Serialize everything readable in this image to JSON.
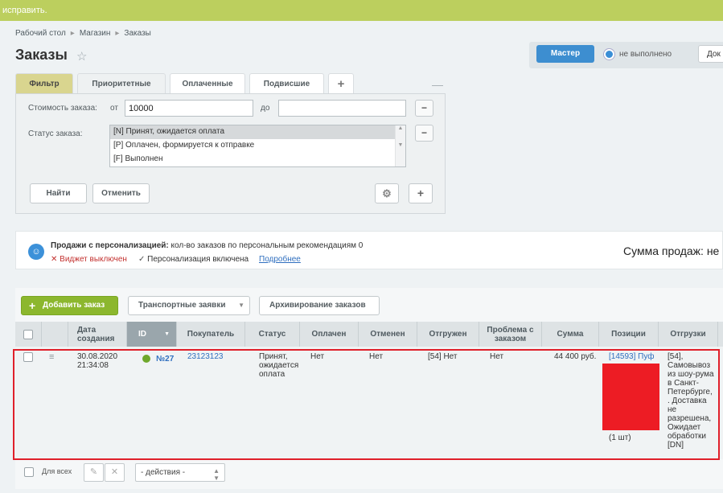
{
  "notice": {
    "text": "исправить."
  },
  "breadcrumb": [
    "Рабочий стол",
    "Магазин",
    "Заказы"
  ],
  "page": {
    "title": "Заказы"
  },
  "master": {
    "button": "Мастер",
    "status": "не выполнено",
    "doc_button": "Док"
  },
  "filter_tabs": [
    "Фильтр",
    "Приоритетные",
    "Оплаченные",
    "Подвисшие"
  ],
  "filter": {
    "price_label": "Стоимость заказа:",
    "from_label": "от",
    "from_value": "10000",
    "to_label": "до",
    "to_value": "",
    "status_label": "Статус заказа:",
    "status_options": [
      "[N] Принят, ожидается оплата",
      "[P] Оплачен, формируется к отправке",
      "[F] Выполнен"
    ],
    "find_button": "Найти",
    "cancel_button": "Отменить"
  },
  "promo": {
    "title_bold": "Продажи с персонализацией:",
    "title_rest": " кол-во заказов по персональным рекомендациям 0",
    "widget_off": "Виджет выключен",
    "personalization_on": "Персонализация включена",
    "more_link": "Подробнее",
    "sum_text": "Сумма продаж: не"
  },
  "toolbar": {
    "add_order": "Добавить заказ",
    "transport": "Транспортные заявки",
    "archive": "Архивирование заказов"
  },
  "columns": {
    "date": "Дата создания",
    "id": "ID",
    "buyer": "Покупатель",
    "status": "Статус",
    "paid": "Оплачен",
    "canceled": "Отменен",
    "shipped": "Отгружен",
    "problem": "Проблема с заказом",
    "sum": "Сумма",
    "positions": "Позиции",
    "shipments": "Отгрузки"
  },
  "order": {
    "date": "30.08.2020",
    "time": "21:34:08",
    "id": "№27",
    "buyer": "23123123",
    "status": "Принят, ожидается оплата",
    "paid": "Нет",
    "canceled": "Нет",
    "shipped": "[54] Нет",
    "problem": "Нет",
    "sum": "44 400 руб.",
    "position_link": "[14593] Пуф",
    "position_qty": "(1 шт)",
    "shipment": "[54], Самовывоз из шоу-рума в Санкт-Петербурге, . Доставка не разрешена, Ожидает обработки [DN]"
  },
  "footer": {
    "for_all": "Для всех",
    "actions": "- действия -"
  },
  "colors": {
    "accent_green": "#8cb72e",
    "notice_bar": "#bccf5e",
    "highlight_frame": "#e0202a",
    "redaction": "#ed1c24"
  }
}
